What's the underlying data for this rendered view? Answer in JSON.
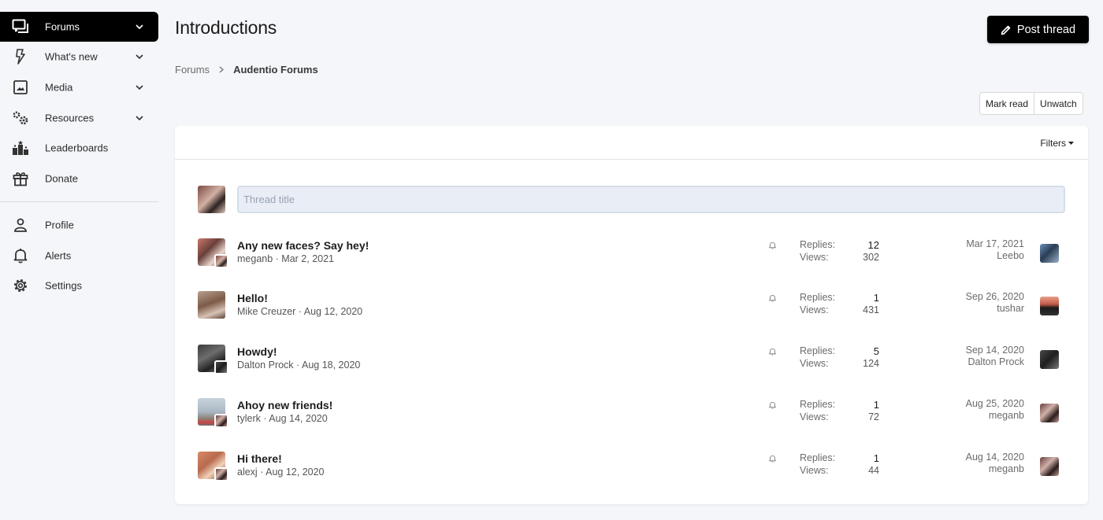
{
  "sidebar": {
    "items": [
      {
        "label": "Forums",
        "icon": "forums-icon",
        "active": true,
        "has_chevron": true
      },
      {
        "label": "What's new",
        "icon": "lightning-icon",
        "active": false,
        "has_chevron": true
      },
      {
        "label": "Media",
        "icon": "image-icon",
        "active": false,
        "has_chevron": true
      },
      {
        "label": "Resources",
        "icon": "cogs-icon",
        "active": false,
        "has_chevron": true
      },
      {
        "label": "Leaderboards",
        "icon": "podium-icon",
        "active": false,
        "has_chevron": false
      },
      {
        "label": "Donate",
        "icon": "gift-icon",
        "active": false,
        "has_chevron": false
      }
    ],
    "account_items": [
      {
        "label": "Profile",
        "icon": "user-icon"
      },
      {
        "label": "Alerts",
        "icon": "bell-icon"
      },
      {
        "label": "Settings",
        "icon": "gear-icon"
      }
    ]
  },
  "header": {
    "title": "Introductions",
    "post_thread_label": "Post thread"
  },
  "breadcrumb": {
    "items": [
      "Forums",
      "Audentio Forums"
    ]
  },
  "actions": {
    "mark_read": "Mark read",
    "unwatch": "Unwatch"
  },
  "list": {
    "filters_label": "Filters",
    "thread_title_placeholder": "Thread title",
    "replies_label": "Replies:",
    "views_label": "Views:",
    "threads": [
      {
        "title": "Any new faces? Say hey!",
        "author": "meganb",
        "date": "Mar 2, 2021",
        "replies": "12",
        "views": "302",
        "last_date": "Mar 17, 2021",
        "last_user": "Leebo"
      },
      {
        "title": "Hello!",
        "author": "Mike Creuzer",
        "date": "Aug 12, 2020",
        "replies": "1",
        "views": "431",
        "last_date": "Sep 26, 2020",
        "last_user": "tushar"
      },
      {
        "title": "Howdy!",
        "author": "Dalton Prock",
        "date": "Aug 18, 2020",
        "replies": "5",
        "views": "124",
        "last_date": "Sep 14, 2020",
        "last_user": "Dalton Prock"
      },
      {
        "title": "Ahoy new friends!",
        "author": "tylerk",
        "date": "Aug 14, 2020",
        "replies": "1",
        "views": "72",
        "last_date": "Aug 25, 2020",
        "last_user": "meganb"
      },
      {
        "title": "Hi there!",
        "author": "alexj",
        "date": "Aug 12, 2020",
        "replies": "1",
        "views": "44",
        "last_date": "Aug 14, 2020",
        "last_user": "meganb"
      }
    ]
  },
  "colors": {
    "accent": "#000000",
    "background": "#f5f6fa",
    "input_background": "#e9edf5"
  }
}
